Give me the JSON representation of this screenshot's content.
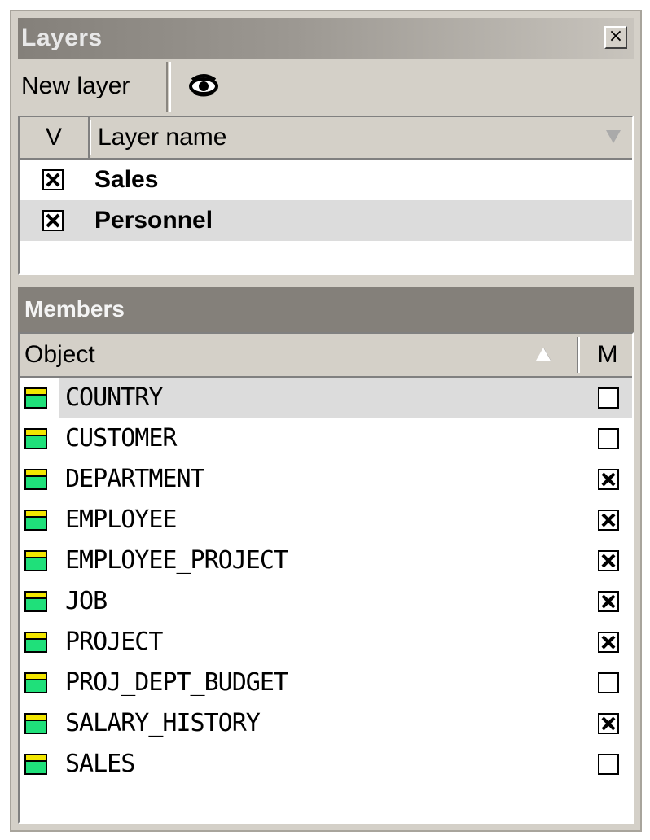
{
  "layers_panel": {
    "title": "Layers",
    "close_glyph": "×",
    "toolbar": {
      "new_layer_label": "New layer",
      "visibility_icon": "eye-icon"
    },
    "grid": {
      "col_visible": "V",
      "col_name": "Layer name",
      "rows": [
        {
          "name": "Sales",
          "visible": true
        },
        {
          "name": "Personnel",
          "visible": true,
          "selected": true
        }
      ]
    }
  },
  "members_panel": {
    "title": "Members",
    "col_object": "Object",
    "col_member": "M",
    "rows": [
      {
        "name": "COUNTRY",
        "member": false,
        "selected": true
      },
      {
        "name": "CUSTOMER",
        "member": false
      },
      {
        "name": "DEPARTMENT",
        "member": true
      },
      {
        "name": "EMPLOYEE",
        "member": true
      },
      {
        "name": "EMPLOYEE_PROJECT",
        "member": true
      },
      {
        "name": "JOB",
        "member": true
      },
      {
        "name": "PROJECT",
        "member": true
      },
      {
        "name": "PROJ_DEPT_BUDGET",
        "member": false
      },
      {
        "name": "SALARY_HISTORY",
        "member": true
      },
      {
        "name": "SALES",
        "member": false
      }
    ]
  },
  "colors": {
    "table_icon_fill": "#1fe07a",
    "table_icon_header": "#f2e600",
    "selection": "#dcdcdc"
  }
}
